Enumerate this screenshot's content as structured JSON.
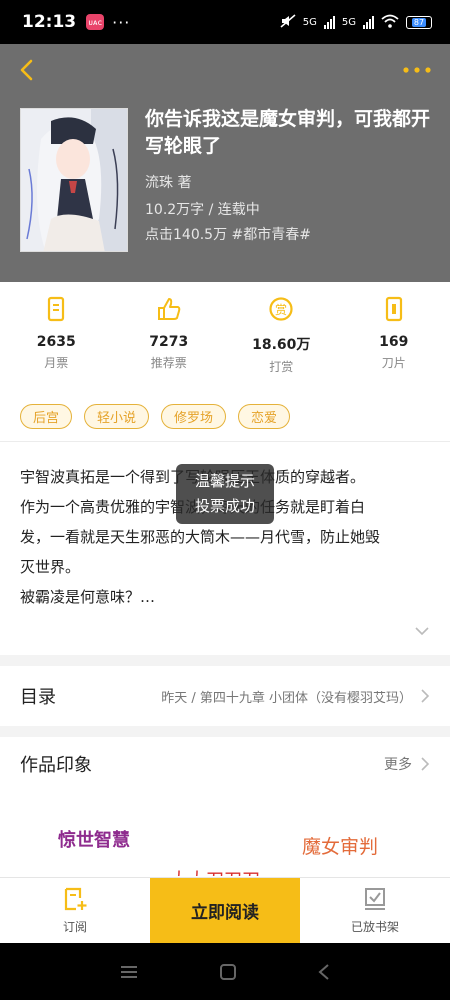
{
  "status_bar": {
    "time": "12:13",
    "app_badge": "ᴜᴀᴄ",
    "dots": "···",
    "net1": "5G",
    "net2": "5G",
    "battery": "87"
  },
  "book": {
    "title": "你告诉我这是魔女审判，可我都开写轮眼了",
    "author": "流珠  著",
    "meta_words": "10.2万字 / 连载中",
    "meta_clicks": "点击140.5万  #都市青春#"
  },
  "stats": [
    {
      "value": "2635",
      "label": "月票",
      "icon": "ticket-icon"
    },
    {
      "value": "7273",
      "label": "推荐票",
      "icon": "thumbs-up-icon"
    },
    {
      "value": "18.60万",
      "label": "打赏",
      "icon": "reward-coin-icon"
    },
    {
      "value": "169",
      "label": "刀片",
      "icon": "blade-icon"
    }
  ],
  "tags": [
    "后宫",
    "轻小说",
    "修罗场",
    "恋爱"
  ],
  "synopsis": [
    "宇智波真拓是一个得到了写轮眼压王体质的穿越者。",
    "作为一个高贵优雅的宇智波，每天的任务就是盯着白",
    "发，一看就是天生邪恶的大筒木——月代雪，防止她毁",
    "灭世界。",
    "被霸凌是何意味？…"
  ],
  "toc": {
    "title": "目录",
    "latest": "昨天 / 第四十九章 小团体（没有樱羽艾玛）"
  },
  "impressions": {
    "title": "作品印象",
    "more": "更多",
    "words": [
      "惊世智慧",
      "魔女审判",
      "大大刀刀刀"
    ]
  },
  "toast": {
    "line1": "温馨提示",
    "line2": "投票成功"
  },
  "bottom_bar": {
    "subscribe": "订阅",
    "read_now": "立即阅读",
    "shelf": "已放书架"
  },
  "colors": {
    "accent": "#f6bd17",
    "header_bg": "#6e6e6e",
    "tag_border": "#e5b23a"
  }
}
